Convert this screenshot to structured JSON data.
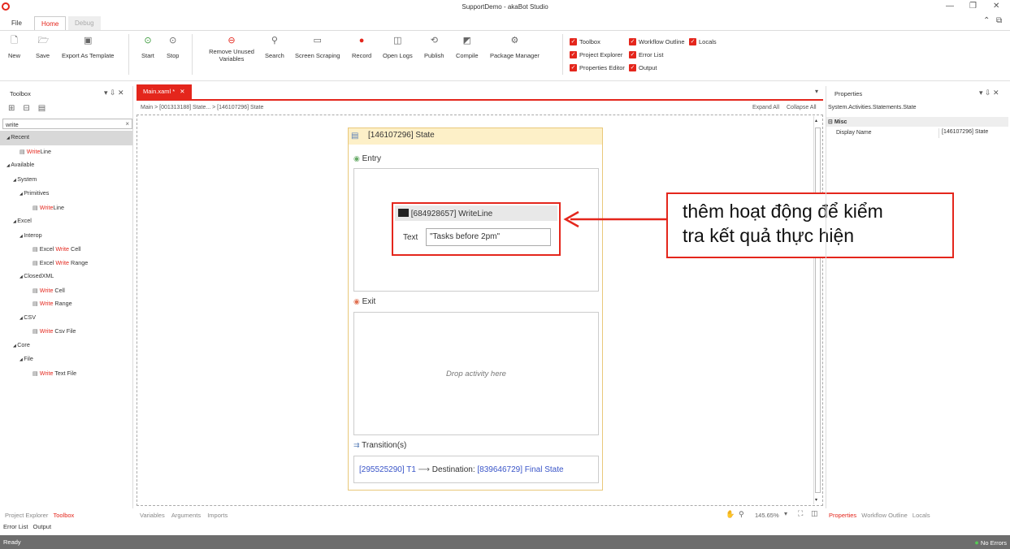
{
  "window": {
    "title": "SupportDemo - akaBot Studio"
  },
  "menu": {
    "tabs": [
      "File",
      "Home",
      "Debug"
    ]
  },
  "ribbon": {
    "buttons": [
      "New",
      "Save",
      "Export As Template",
      "Start",
      "Stop",
      "Remove Unused Variables",
      "Search",
      "Screen Scraping",
      "Record",
      "Open Logs",
      "Publish",
      "Compile",
      "Package Manager"
    ],
    "checks": [
      "Toolbox",
      "Workflow Outline",
      "Locals",
      "Project Explorer",
      "Error List",
      "Properties Editor",
      "Output"
    ]
  },
  "toolbox": {
    "title": "Toolbox",
    "search_value": "write",
    "items": [
      {
        "label": "Recent",
        "level": 0,
        "kind": "group"
      },
      {
        "pre": "",
        "hl": "Write",
        "post": "Line",
        "level": 1,
        "kind": "leaf"
      },
      {
        "label": "Available",
        "level": 0,
        "kind": "group"
      },
      {
        "label": "System",
        "level": 1,
        "kind": "group"
      },
      {
        "label": "Primitives",
        "level": 2,
        "kind": "group"
      },
      {
        "pre": "",
        "hl": "Write",
        "post": "Line",
        "level": 3,
        "kind": "leaf"
      },
      {
        "label": "Excel",
        "level": 1,
        "kind": "group"
      },
      {
        "label": "Interop",
        "level": 2,
        "kind": "group"
      },
      {
        "pre": "Excel ",
        "hl": "Write",
        "post": " Cell",
        "level": 3,
        "kind": "leaf"
      },
      {
        "pre": "Excel ",
        "hl": "Write",
        "post": " Range",
        "level": 3,
        "kind": "leaf"
      },
      {
        "label": "ClosedXML",
        "level": 2,
        "kind": "group"
      },
      {
        "pre": "",
        "hl": "Write",
        "post": " Cell",
        "level": 3,
        "kind": "leaf"
      },
      {
        "pre": "",
        "hl": "Write",
        "post": " Range",
        "level": 3,
        "kind": "leaf"
      },
      {
        "label": "CSV",
        "level": 2,
        "kind": "group"
      },
      {
        "pre": "",
        "hl": "Write",
        "post": " Csv File",
        "level": 3,
        "kind": "leaf"
      },
      {
        "label": "Core",
        "level": 1,
        "kind": "group"
      },
      {
        "label": "File",
        "level": 2,
        "kind": "group"
      },
      {
        "pre": "",
        "hl": "Write",
        "post": " Text File",
        "level": 3,
        "kind": "leaf"
      }
    ],
    "bottom_tabs": [
      "Project Explorer",
      "Toolbox"
    ],
    "bottom_tabs2": [
      "Error List",
      "Output"
    ]
  },
  "editor": {
    "doc_tab": "Main.xaml *",
    "breadcrumb": "Main  >  [001313188] State...  >  [146107296] State",
    "expand": "Expand All",
    "collapse": "Collapse All",
    "state_title": "[146107296] State",
    "entry": "Entry",
    "exit": "Exit",
    "drop_hint": "Drop activity here",
    "transitions": "Transition(s)",
    "transition_id": "[295525290] T1",
    "destination_label": "Destination:",
    "destination_value": "[839646729] Final State",
    "activity_title": "[684928657] WriteLine",
    "text_label": "Text",
    "text_value": "\"Tasks before 2pm\"",
    "bottom_tabs": [
      "Variables",
      "Arguments",
      "Imports"
    ],
    "zoom": "145.65%"
  },
  "callout": {
    "line1": "thêm hoạt động để kiểm",
    "line2": "tra kết quả thực hiện"
  },
  "properties": {
    "title": "Properties",
    "type": "System.Activities.Statements.State",
    "category": "Misc",
    "prop_name": "Display Name",
    "prop_value": "[146107296] State",
    "bottom_tabs": [
      "Properties",
      "Workflow Outline",
      "Locals"
    ]
  },
  "status": {
    "left": "Ready",
    "right": "No Errors"
  }
}
